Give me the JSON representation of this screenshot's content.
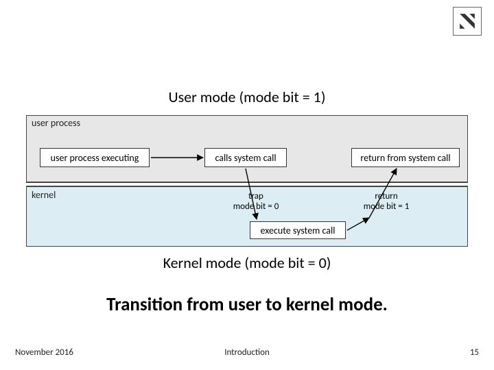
{
  "headings": {
    "user_mode": "User mode (mode bit = 1)",
    "kernel_mode": "Kernel mode (mode bit = 0)"
  },
  "diagram": {
    "region_labels": {
      "user": "user process",
      "kernel": "kernel"
    },
    "boxes": {
      "exec": "user process executing",
      "call": "calls system call",
      "return": "return from system call",
      "execsys": "execute system call"
    },
    "annotations": {
      "trap_line1": "trap",
      "trap_line2": "mode bit = 0",
      "return_line1": "return",
      "return_line2": "mode bit = 1"
    }
  },
  "caption": "Transition from user to kernel mode.",
  "footer": {
    "date": "November 2016",
    "title": "Introduction",
    "page": "15"
  }
}
